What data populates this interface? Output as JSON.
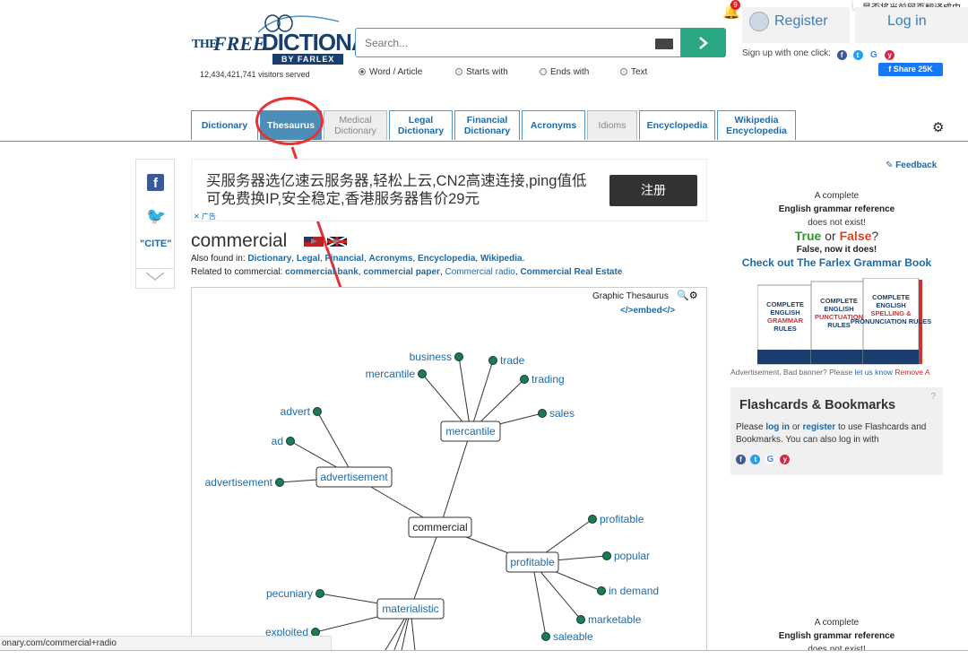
{
  "browser": {
    "translate_prompt": "是否将当前网页翻译成中",
    "status_url": "onary.com/commercial+radio",
    "notification_count": "9"
  },
  "header": {
    "logo": {
      "the": "THE",
      "free": "FREE",
      "dictionary": "DICTIONARY",
      "by": "BY FARLEX"
    },
    "visitors": "12,434,421,741 visitors served",
    "search": {
      "placeholder": "Search...",
      "button_icon": "chevron-right-icon"
    },
    "modes": [
      "Word / Article",
      "Starts with",
      "Ends with",
      "Text"
    ],
    "selected_mode": "Word / Article",
    "register": "Register",
    "login": "Log in",
    "signup": "Sign up with one click:",
    "share": "Share 25K"
  },
  "tabs": [
    {
      "label": "Dictionary",
      "state": "normal"
    },
    {
      "label": "Thesaurus",
      "state": "active"
    },
    {
      "label": "Medical Dictionary",
      "state": "muted"
    },
    {
      "label": "Legal Dictionary",
      "state": "normal"
    },
    {
      "label": "Financial Dictionary",
      "state": "normal"
    },
    {
      "label": "Acronyms",
      "state": "normal"
    },
    {
      "label": "Idioms",
      "state": "muted"
    },
    {
      "label": "Encyclopedia",
      "state": "normal"
    },
    {
      "label": "Wikipedia Encyclopedia",
      "state": "normal"
    }
  ],
  "share_col": {
    "cite": "\"CITE\""
  },
  "ad": {
    "text": "买服务器选亿速云服务器,轻松上云,CN2高速连接,ping值低可免费换IP,安全稳定,香港服务器售价29元",
    "button": "注册",
    "mark": "✕ 广告"
  },
  "entry": {
    "word": "commercial",
    "also_found_label": "Also found in:",
    "also_found": [
      "Dictionary",
      "Legal",
      "Financial",
      "Acronyms",
      "Encyclopedia",
      "Wikipedia"
    ],
    "related_label": "Related to commercial:",
    "related": [
      "commercial bank",
      "commercial paper",
      "Commercial radio",
      "Commercial Real Estate"
    ]
  },
  "graphic_thesaurus": {
    "title": "Graphic Thesaurus",
    "embed": "</>embed</>",
    "center": "commercial",
    "groups": [
      {
        "label": "mercantile",
        "words": [
          "business",
          "trade",
          "mercantile",
          "trading",
          "sales"
        ]
      },
      {
        "label": "advertisement",
        "words": [
          "advert",
          "ad",
          "advertisement"
        ]
      },
      {
        "label": "profitable",
        "words": [
          "profitable",
          "popular",
          "in demand",
          "marketable",
          "saleable"
        ]
      },
      {
        "label": "materialistic",
        "words": [
          "pecuniary",
          "exploited"
        ]
      }
    ]
  },
  "sidebar": {
    "feedback": "Feedback",
    "promo": {
      "line1": "A complete",
      "line2": "English grammar reference",
      "line3": "does not exist!",
      "true": "True",
      "or": "or",
      "false": "False",
      "q": "?",
      "line5": "False, now it does!",
      "link": "Check out The Farlex Grammar Book"
    },
    "books": [
      "COMPLETE ENGLISH GRAMMAR RULES",
      "COMPLETE ENGLISH PUNCTUATION RULES",
      "COMPLETE ENGLISH SPELLING & PRONUNCIATION RULES"
    ],
    "adv_line": "Advertisement. Bad banner? Please",
    "adv_link": "let us know",
    "adv_remove": "Remove A",
    "flash": {
      "title": "Flashcards & Bookmarks",
      "q": "?",
      "text_a": "Please",
      "login": "log in",
      "text_b": "or",
      "register": "register",
      "text_c": "to use Flashcards and Bookmarks. You can also log in with"
    },
    "promo2": {
      "line1": "A complete",
      "line2": "English grammar reference",
      "line3": "does not exist!"
    }
  },
  "colors": {
    "accent": "#4c93c8",
    "tab_active": "#4b8fb8",
    "search_button": "#2aa783",
    "node_dot": "#1d7a54",
    "annotation": "#e53333"
  }
}
